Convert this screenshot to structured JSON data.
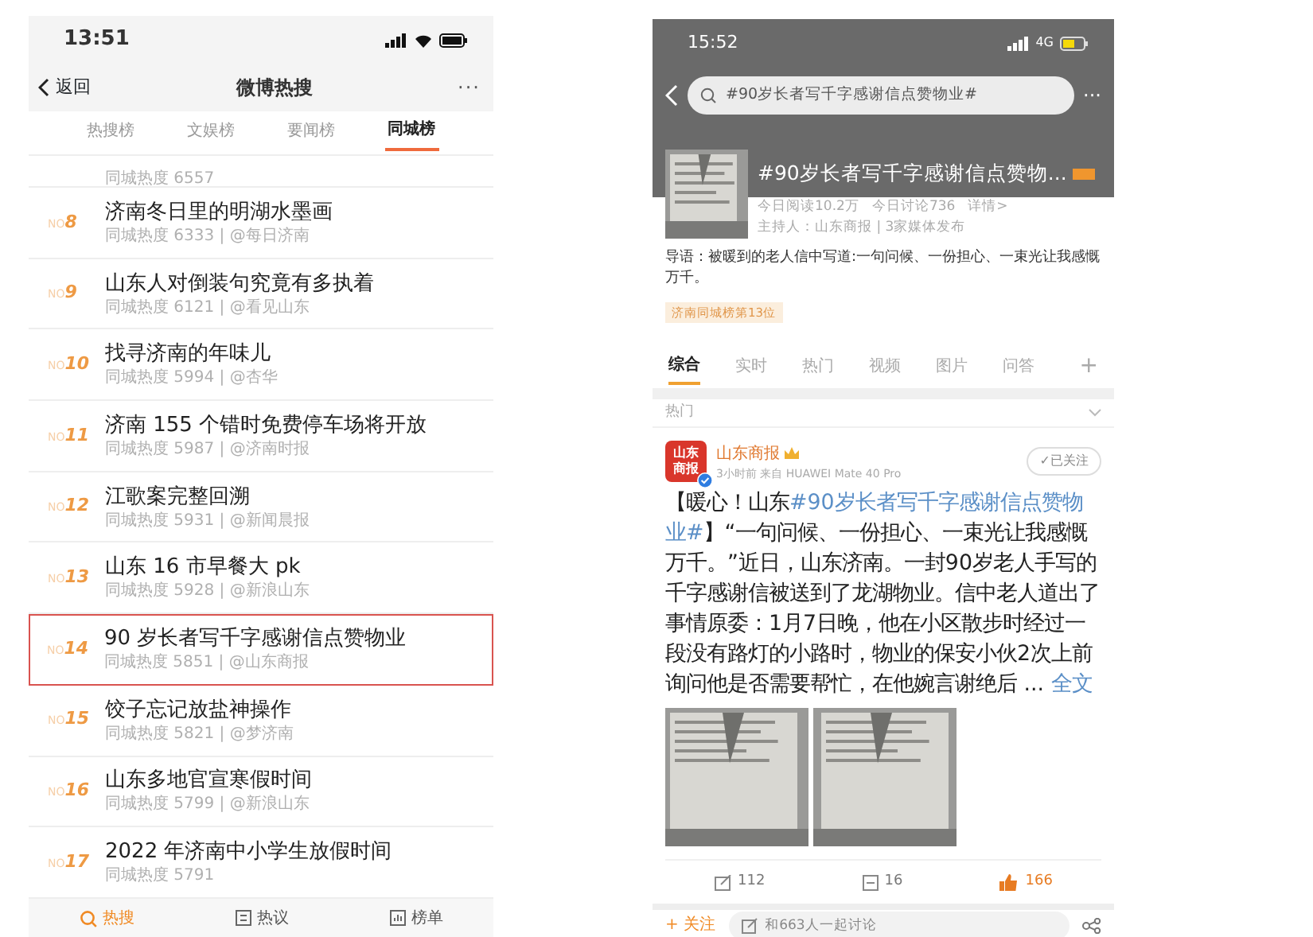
{
  "left_phone": {
    "status_bar": {
      "time": "13:51"
    },
    "nav": {
      "back": "返回",
      "title": "微博热搜",
      "more": "···"
    },
    "tabs": [
      {
        "label": "热搜榜",
        "selected": false
      },
      {
        "label": "文娱榜",
        "selected": false
      },
      {
        "label": "要闻榜",
        "selected": false
      },
      {
        "label": "同城榜",
        "selected": true
      }
    ],
    "partial_row": {
      "meta": "同城热度 6557"
    },
    "rows": [
      {
        "rank_prefix": "NO",
        "rank": "8",
        "title": "济南冬日里的明湖水墨画",
        "meta": "同城热度 6333 | @每日济南",
        "highlighted": false
      },
      {
        "rank_prefix": "NO",
        "rank": "9",
        "title": "山东人对倒装句究竟有多执着",
        "meta": "同城热度 6121 | @看见山东",
        "highlighted": false
      },
      {
        "rank_prefix": "NO",
        "rank": "10",
        "title": "找寻济南的年味儿",
        "meta": "同城热度 5994 | @杏华",
        "highlighted": false
      },
      {
        "rank_prefix": "NO",
        "rank": "11",
        "title": "济南 155 个错时免费停车场将开放",
        "meta": "同城热度 5987 | @济南时报",
        "highlighted": false
      },
      {
        "rank_prefix": "NO",
        "rank": "12",
        "title": "江歌案完整回溯",
        "meta": "同城热度 5931 | @新闻晨报",
        "highlighted": false
      },
      {
        "rank_prefix": "NO",
        "rank": "13",
        "title": "山东 16 市早餐大 pk",
        "meta": "同城热度 5928 | @新浪山东",
        "highlighted": false
      },
      {
        "rank_prefix": "NO",
        "rank": "14",
        "title": "90 岁长者写千字感谢信点赞物业",
        "meta": "同城热度 5851 | @山东商报",
        "highlighted": true
      },
      {
        "rank_prefix": "NO",
        "rank": "15",
        "title": "饺子忘记放盐神操作",
        "meta": "同城热度 5821 | @梦济南",
        "highlighted": false
      },
      {
        "rank_prefix": "NO",
        "rank": "16",
        "title": "山东多地官宣寒假时间",
        "meta": "同城热度 5799 | @新浪山东",
        "highlighted": false
      },
      {
        "rank_prefix": "NO",
        "rank": "17",
        "title": "2022 年济南中小学生放假时间",
        "meta": "同城热度 5791",
        "highlighted": false
      }
    ],
    "bottom_tabs": [
      {
        "label": "热搜",
        "selected": true
      },
      {
        "label": "热议",
        "selected": false
      },
      {
        "label": "榜单",
        "selected": false
      }
    ]
  },
  "right_phone": {
    "status_bar": {
      "time": "15:52",
      "network": "4G"
    },
    "search": {
      "value": "#90岁长者写千字感谢信点赞物业#",
      "more": "···"
    },
    "topic": {
      "title": "#90岁长者写千字感谢信点赞物...",
      "reads": "今日阅读10.2万",
      "discussions": "今日讨论736",
      "details": "详情>",
      "host": "主持人：山东商报 | 3家媒体发布"
    },
    "intro": "导语：被暖到的老人信中写道:一句问候、一份担心、一束光让我感慨万千。",
    "rank_tag": "济南同城榜第13位",
    "tabs": [
      {
        "label": "综合",
        "selected": true
      },
      {
        "label": "实时",
        "selected": false
      },
      {
        "label": "热门",
        "selected": false
      },
      {
        "label": "视频",
        "selected": false
      },
      {
        "label": "图片",
        "selected": false
      },
      {
        "label": "问答",
        "selected": false
      }
    ],
    "add_tab": "+",
    "section": {
      "label": "热门"
    },
    "post": {
      "avatar_text": "山东商报",
      "author": "山东商报",
      "meta": "3小时前  来自 HUAWEI Mate 40 Pro",
      "follow": "✓已关注",
      "body": "【暖心！山东**#90岁长者写千字感谢信点赞物业#**】“一句问候、一份担心、一束光让我感慨万千。”近日，山东济南。一封90岁老人手写的千字感谢信被送到了龙湖物业。信中老人道出了事情原委：1月7日晚，他在小区散步时经过一段没有路灯的小路时，物业的保安小伙2次上前询问他是否需要帮忙，在他婉言谢绝后 ...",
      "more": "全文",
      "reposts": "112",
      "comments": "16",
      "likes": "166",
      "liked": true
    },
    "bottom_bar": {
      "follow": "+ 关注",
      "placeholder": "和663人一起讨论"
    }
  }
}
